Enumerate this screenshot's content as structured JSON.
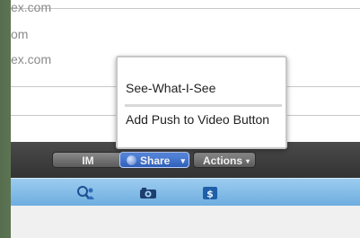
{
  "email_list": {
    "rows": [
      "ex.com",
      "om",
      "ex.com"
    ]
  },
  "toolbar": {
    "im_label": "IM",
    "share_label": "Share",
    "share_caret": "▾",
    "actions_label": "Actions",
    "actions_caret": "▾"
  },
  "menu": {
    "items": [
      "See-What-I-See",
      "Add Push to Video Button"
    ]
  },
  "icons": {
    "iconbar": [
      "search-people-icon",
      "camera-icon",
      "money-icon"
    ]
  },
  "colors": {
    "toolbar": "#3b3b3b",
    "share_button": "#3a6bc8",
    "iconbar": "#8cc0ea"
  }
}
